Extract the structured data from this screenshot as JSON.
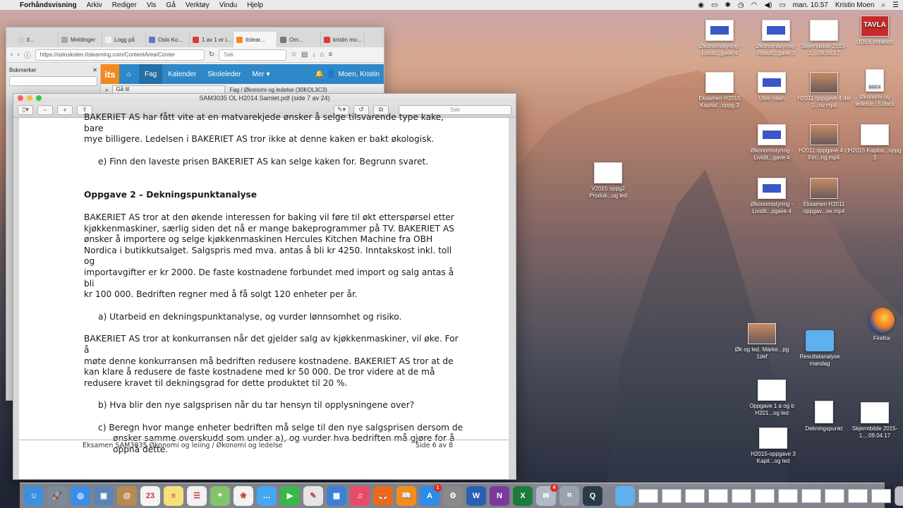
{
  "menubar": {
    "app": "Forhåndsvisning",
    "items": [
      "Arkiv",
      "Rediger",
      "Vis",
      "Gå",
      "Verktøy",
      "Vindu",
      "Hjelp"
    ],
    "clock": "man. 10.57",
    "user": "Kristin Moen"
  },
  "browser": {
    "tabs": [
      {
        "label": "it..."
      },
      {
        "label": "Meldinger"
      },
      {
        "label": "Logg på"
      },
      {
        "label": "Oslo Ko..."
      },
      {
        "label": "1 av 1 er l..."
      },
      {
        "label": "itslear..."
      },
      {
        "label": "Om..."
      },
      {
        "label": "kristin mo..."
      }
    ],
    "url": "https://osloskolen.itslearning.com/ContentArea/Conter",
    "search_placeholder": "Søk",
    "sidebar_title": "Bokmerker",
    "its": {
      "logo": "its",
      "nav": [
        "Fag",
        "Kalender",
        "Skoleleder",
        "Mer ▾"
      ],
      "user": "Moen, Kristin",
      "goto": "Gå til",
      "crumb": "Fag  /  Økonomi og ledelse (30KOL3C3)"
    }
  },
  "preview": {
    "title": "SAM3035 OL H2014 Samlet.pdf (side 7 av 24)",
    "search_placeholder": "Søk",
    "lines": [
      {
        "kind": "plain",
        "text": "BAKERIET AS har fått vite at en matvarekjede ønsker å selge tilsvarende type kake, bare"
      },
      {
        "kind": "plain",
        "text": "mye billigere. Ledelsen i BAKERIET AS tror ikke at denne kaken er bakt økologisk."
      },
      {
        "kind": "gap"
      },
      {
        "kind": "sub",
        "text": "e)   Finn den laveste prisen BAKERIET AS kan selge kaken for. Begrunn svaret."
      },
      {
        "kind": "gap"
      },
      {
        "kind": "gap"
      },
      {
        "kind": "heading",
        "text": "Oppgave 2 – Dekningspunktanalyse"
      },
      {
        "kind": "gap"
      },
      {
        "kind": "plain",
        "text": "BAKERIET AS tror at den økende interessen for baking vil føre til økt etterspørsel etter"
      },
      {
        "kind": "plain",
        "text": "kjøkkenmaskiner, særlig siden det nå er mange bakeprogrammer på TV. BAKERIET AS"
      },
      {
        "kind": "plain",
        "text": "ønsker å importere og selge kjøkkenmaskinen Hercules Kitchen Machine fra OBH"
      },
      {
        "kind": "plain",
        "text": "Nordica i butikkutsalget. Salgspris med mva. antas å bli kr 4250. Inntakskost inkl. toll og"
      },
      {
        "kind": "plain",
        "text": "importavgifter er kr 2000. De faste kostnadene forbundet med import og salg antas å bli"
      },
      {
        "kind": "plain",
        "text": "kr 100 000. Bedriften regner med å få solgt 120 enheter per år."
      },
      {
        "kind": "gap"
      },
      {
        "kind": "sub",
        "text": "a)   Utarbeid en dekningspunktanalyse, og vurder lønnsomhet og risiko."
      },
      {
        "kind": "gap"
      },
      {
        "kind": "plain",
        "text": "BAKERIET AS tror at konkurransen når det gjelder salg av kjøkkenmaskiner, vil øke. For å"
      },
      {
        "kind": "plain",
        "text": "møte denne konkurransen må bedriften redusere kostnadene. BAKERIET AS tror at de"
      },
      {
        "kind": "plain",
        "text": "kan klare å redusere de faste kostnadene med kr 50 000. De tror videre at de må"
      },
      {
        "kind": "plain",
        "text": "redusere kravet til dekningsgrad for dette produktet til 20 %."
      },
      {
        "kind": "gap"
      },
      {
        "kind": "sub",
        "text": "b)   Hva blir den nye salgsprisen når du tar hensyn til opplysningene over?"
      },
      {
        "kind": "gap"
      },
      {
        "kind": "sub",
        "text": "c)   Beregn hvor mange enheter bedriften må selge til den nye salgsprisen dersom de"
      },
      {
        "kind": "sub2",
        "text": "ønsker samme overskudd som under a), og vurder hva bedriften må gjøre for å"
      },
      {
        "kind": "sub2",
        "text": "oppnå dette."
      }
    ],
    "footer_left": "Eksamen SAM3035 Økonomi og leiing / Økonomi og ledelse",
    "footer_right": "Side 6 av 8"
  },
  "desktop": {
    "icons": [
      {
        "id": "d1",
        "label": "Økonomistyring-Lividit...gave 4",
        "style": "blue"
      },
      {
        "id": "d2",
        "label": "Økonomistyring-Result...gave 3",
        "style": "blue"
      },
      {
        "id": "d3",
        "label": "Skjermbilde 2015-1....09.06.17",
        "style": "doc-wide"
      },
      {
        "id": "d4",
        "label": "UDEs intranett",
        "style": "tavla",
        "glyph": "TAVLA"
      },
      {
        "id": "d5",
        "label": "Eksamen H2015 Kapital...oppg 3",
        "style": "plain"
      },
      {
        "id": "d6",
        "label": "Uten navn",
        "style": "blue"
      },
      {
        "id": "d7",
        "label": "H2011 oppgave 4 del 1...ov.mp4",
        "style": "photo"
      },
      {
        "id": "d8",
        "label": "Økonomi og ledelse...5.docx",
        "style": "doc",
        "glyph": "DOCX"
      },
      {
        "id": "d9",
        "label": "Økonomistyring - Lividit...gave 4",
        "style": "blue"
      },
      {
        "id": "d10",
        "label": "H2011 oppgave 4 c) Fin...ng.mp4",
        "style": "photo"
      },
      {
        "id": "d11",
        "label": "H2015 Kapital...oppg 3",
        "style": "plain"
      },
      {
        "id": "d12",
        "label": "V2015 oppg2 Produk...og led",
        "style": "plain"
      },
      {
        "id": "d13",
        "label": "Økonomistyring -Lividit...pgave 4",
        "style": "blue"
      },
      {
        "id": "d14",
        "label": "Eksamen H2011 oppgav...se.mp4",
        "style": "photo"
      },
      {
        "id": "d15",
        "label": "Firefox",
        "style": "firefox"
      },
      {
        "id": "d16",
        "label": "Øk og led. Marke...pg 1def",
        "style": "photo"
      },
      {
        "id": "d17",
        "label": "Resultatanalyse mandag",
        "style": "folder"
      },
      {
        "id": "d18",
        "label": "Oppgave 1 a og b H201...og led",
        "style": "plain"
      },
      {
        "id": "d19",
        "label": "Dekningspunkt",
        "style": "doc"
      },
      {
        "id": "d20",
        "label": "Skjermbilde 2015-1....09.04.17",
        "style": "plain"
      },
      {
        "id": "d21",
        "label": "H2015-oppgave 3 Kapit...og led",
        "style": "plain"
      }
    ]
  },
  "dock": {
    "apps": [
      {
        "name": "finder",
        "color": "#3e8fe0",
        "glyph": "☺"
      },
      {
        "name": "launchpad",
        "color": "#7d8a9a",
        "glyph": "🚀"
      },
      {
        "name": "safari",
        "color": "#3a8ee6",
        "glyph": "◎"
      },
      {
        "name": "preview",
        "color": "#5d84b6",
        "glyph": "▣"
      },
      {
        "name": "contacts",
        "color": "#b68b4e",
        "glyph": "@"
      },
      {
        "name": "calendar",
        "color": "#f4f4f4",
        "glyph": "23"
      },
      {
        "name": "notes",
        "color": "#f5e07a",
        "glyph": "≡"
      },
      {
        "name": "reminders",
        "color": "#f1f1f1",
        "glyph": "☰"
      },
      {
        "name": "maps",
        "color": "#83c36b",
        "glyph": "⌖"
      },
      {
        "name": "photos",
        "color": "#f2f2f2",
        "glyph": "❀"
      },
      {
        "name": "messages",
        "color": "#45a6f2",
        "glyph": "…"
      },
      {
        "name": "facetime",
        "color": "#3cb64b",
        "glyph": "▶"
      },
      {
        "name": "textedit",
        "color": "#e5e5e5",
        "glyph": "✎"
      },
      {
        "name": "keynote",
        "color": "#3d7fd6",
        "glyph": "▦"
      },
      {
        "name": "itunes",
        "color": "#e94b6a",
        "glyph": "♫"
      },
      {
        "name": "firefox",
        "color": "#e86b1f",
        "glyph": "🦊"
      },
      {
        "name": "ibooks",
        "color": "#f28d1b",
        "glyph": "📖"
      },
      {
        "name": "appstore",
        "color": "#2e8be6",
        "glyph": "A",
        "badge": "1"
      },
      {
        "name": "sysprefs",
        "color": "#8a8a8a",
        "glyph": "⚙"
      },
      {
        "name": "word",
        "color": "#2a5fb3",
        "glyph": "W"
      },
      {
        "name": "onenote",
        "color": "#7a3a9c",
        "glyph": "N"
      },
      {
        "name": "excel",
        "color": "#1e7b3c",
        "glyph": "X"
      },
      {
        "name": "mail",
        "color": "#b0b9c8",
        "glyph": "✉",
        "badge": "4"
      },
      {
        "name": "screenshot",
        "color": "#9aa3ad",
        "glyph": "⌗"
      },
      {
        "name": "quicktime",
        "color": "#2b3a4b",
        "glyph": "Q"
      }
    ],
    "right": [
      {
        "name": "folder"
      },
      {
        "name": "win1"
      },
      {
        "name": "win2"
      },
      {
        "name": "win3"
      },
      {
        "name": "win4"
      },
      {
        "name": "win5"
      },
      {
        "name": "win6"
      },
      {
        "name": "win7"
      },
      {
        "name": "win8"
      },
      {
        "name": "win9"
      },
      {
        "name": "win10"
      },
      {
        "name": "win11"
      },
      {
        "name": "trash"
      }
    ]
  },
  "colors": {
    "its_blue": "#2f88c8",
    "its_orange": "#f48a1d",
    "close": "#fc605c",
    "min": "#fdbc40",
    "max": "#34c84a"
  }
}
